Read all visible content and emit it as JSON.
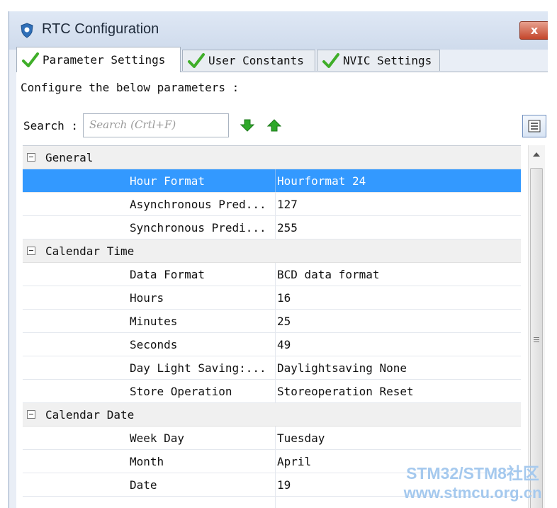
{
  "window": {
    "title": "RTC Configuration",
    "close_label": "x"
  },
  "tabs": [
    {
      "label": "Parameter Settings",
      "active": true,
      "icon": "check-icon"
    },
    {
      "label": "User Constants",
      "active": false,
      "icon": "check-icon"
    },
    {
      "label": "NVIC Settings",
      "active": false,
      "icon": "check-icon"
    }
  ],
  "panel": {
    "description": "Configure the below parameters :",
    "search_label": "Search :",
    "search_placeholder": "Search (Crtl+F)"
  },
  "groups": [
    {
      "label": "General",
      "rows": [
        {
          "name": "Hour Format",
          "value": "Hourformat 24",
          "selected": true
        },
        {
          "name": "Asynchronous Pred...",
          "value": "127"
        },
        {
          "name": "Synchronous Predi...",
          "value": "255"
        }
      ]
    },
    {
      "label": "Calendar Time",
      "rows": [
        {
          "name": "Data Format",
          "value": "BCD data format"
        },
        {
          "name": "Hours",
          "value": "16"
        },
        {
          "name": "Minutes",
          "value": "25"
        },
        {
          "name": "Seconds",
          "value": "49"
        },
        {
          "name": "Day Light Saving:...",
          "value": "Daylightsaving None"
        },
        {
          "name": "Store Operation",
          "value": "Storeoperation Reset"
        }
      ]
    },
    {
      "label": "Calendar Date",
      "rows": [
        {
          "name": "Week Day",
          "value": "Tuesday"
        },
        {
          "name": "Month",
          "value": "April"
        },
        {
          "name": "Date",
          "value": "19"
        },
        {
          "name": "",
          "value": ""
        }
      ]
    }
  ],
  "watermark": {
    "line1": "STM32/STM8社区",
    "line2": "www.stmcu.org.cn"
  },
  "colors": {
    "selected_row": "#3399ff",
    "check_green": "#3fae29",
    "arrow_green": "#2fa82a"
  }
}
